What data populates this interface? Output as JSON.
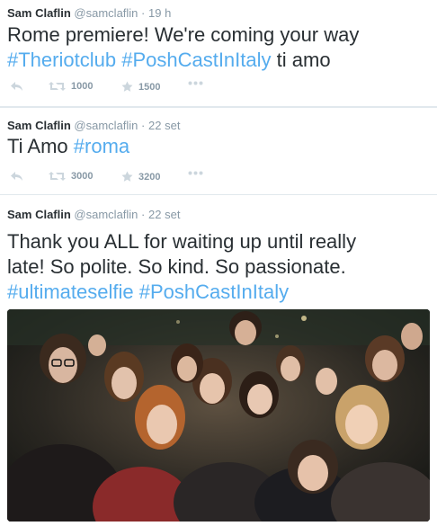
{
  "tweets": [
    {
      "fullname": "Sam Claflin",
      "username": "@samclaflin",
      "separator": "·",
      "time": "19 h",
      "text_plain_1": "Rome premiere! We're coming your way",
      "hashtag_1": "#Theriotclub",
      "hashtag_2": "#PoshCastInItaly",
      "text_plain_2": "ti amo",
      "retweets": "1000",
      "favorites": "1500"
    },
    {
      "fullname": "Sam Claflin",
      "username": "@samclaflin",
      "separator": "·",
      "time": "22 set",
      "text_plain_1": "Ti Amo",
      "hashtag_1": "#roma",
      "retweets": "3000",
      "favorites": "3200"
    },
    {
      "fullname": "Sam Claflin",
      "username": "@samclaflin",
      "separator": "·",
      "time": "22 set",
      "text_line_1": "Thank you ALL for waiting up until really",
      "text_line_2": "late! So polite. So kind. So passionate.",
      "hashtag_1": "#ultimateselfie",
      "hashtag_2": "#PoshCastInItaly"
    }
  ],
  "icons": {
    "reply": "reply-icon",
    "retweet": "retweet-icon",
    "favorite": "star-icon",
    "more": "more-dots-icon"
  },
  "colors": {
    "hashtag": "#55acee",
    "meta": "#8899a6",
    "text": "#292f33",
    "divider": "#e1e8ed"
  }
}
